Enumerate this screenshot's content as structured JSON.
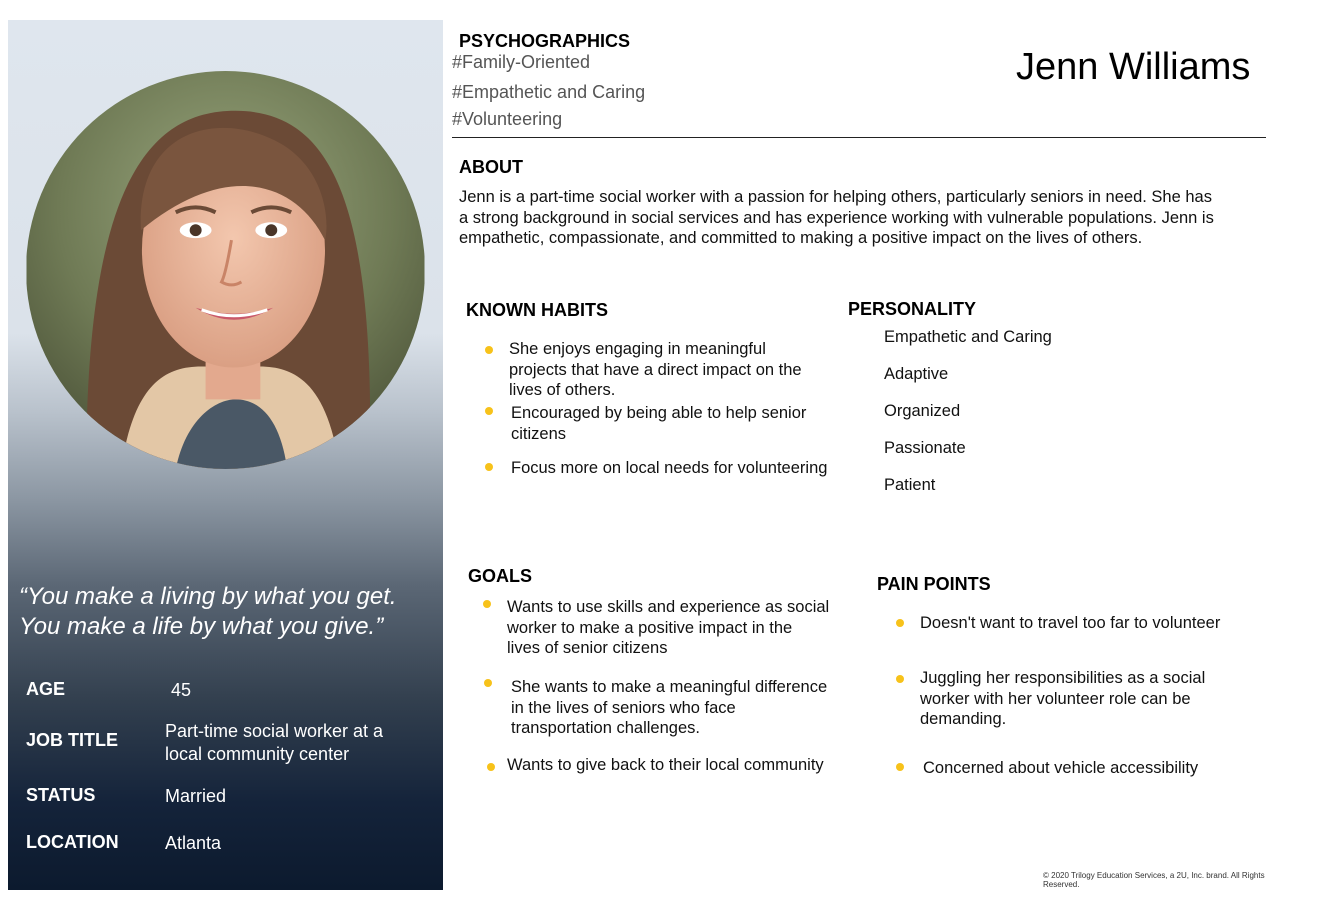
{
  "persona": {
    "name": "Jenn Williams",
    "quote_line1": "“You make a living by what you get.",
    "quote_line2": "You make a life by what you give.”",
    "details": [
      {
        "label": "AGE",
        "value_line1": "45",
        "value_line2": ""
      },
      {
        "label": "JOB TITLE",
        "value_line1": "Part-time social worker at a",
        "value_line2": "local community center"
      },
      {
        "label": "STATUS",
        "value_line1": "Married",
        "value_line2": ""
      },
      {
        "label": "LOCATION",
        "value_line1": "Atlanta",
        "value_line2": ""
      }
    ]
  },
  "psychographics": {
    "heading": "PSYCHOGRAPHICS",
    "tags": [
      "#Family-Oriented",
      "#Empathetic and Caring",
      "#Volunteering"
    ]
  },
  "about": {
    "heading": "ABOUT",
    "lines": [
      "Jenn is a part-time social worker with a passion for helping others, particularly seniors in need. She has",
      "a strong background in social services and has experience working with vulnerable populations. Jenn is",
      "empathetic, compassionate, and committed to making a positive impact on the lives of others."
    ]
  },
  "known_habits": {
    "heading": "KNOWN HABITS",
    "items": [
      {
        "line1": "She enjoys engaging in meaningful",
        "line2": "projects that have a direct impact on the",
        "line3": "lives of others."
      },
      {
        "line1": "Encouraged by being able to help senior",
        "line2": "citizens",
        "line3": ""
      },
      {
        "line1": "Focus more on local needs for volunteering",
        "line2": "",
        "line3": ""
      }
    ]
  },
  "personality": {
    "heading": "PERSONALITY",
    "items": [
      "Empathetic and Caring",
      "Adaptive",
      "Organized",
      "Passionate",
      "Patient"
    ]
  },
  "goals": {
    "heading": "GOALS",
    "items": [
      {
        "line1": "Wants to use skills and experience as social",
        "line2": "worker to make a positive impact in the",
        "line3": "lives of senior citizens"
      },
      {
        "line1": "She wants to make a meaningful difference",
        "line2": "in the lives of seniors who face",
        "line3": "transportation challenges."
      },
      {
        "line1": "Wants to give back to their local community",
        "line2": "",
        "line3": ""
      }
    ]
  },
  "pain_points": {
    "heading": "PAIN POINTS",
    "items": [
      {
        "line1": "Doesn't want to travel too far to volunteer",
        "line2": "",
        "line3": ""
      },
      {
        "line1": "Juggling her responsibilities as a social",
        "line2": "worker with her volunteer role can be",
        "line3": "demanding."
      },
      {
        "line1": "Concerned about vehicle accessibility",
        "line2": "",
        "line3": ""
      }
    ]
  },
  "footer": {
    "copyright_line1": "© 2020 Trilogy Education Services, a 2U, Inc. brand. All Rights",
    "copyright_line2": "Reserved."
  },
  "colors": {
    "bullet": "#f7c21a",
    "panel_dark": "#0c1a2e",
    "panel_light": "#dfe6ee"
  }
}
